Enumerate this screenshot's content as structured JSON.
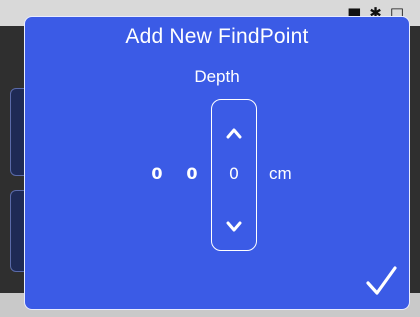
{
  "dialog": {
    "title": "Add New FindPoint",
    "depth_label": "Depth",
    "digits": [
      "0",
      "0"
    ],
    "spinner_value": "0",
    "unit": "cm",
    "confirm_icon": "checkmark-icon"
  },
  "colors": {
    "dialog_background": "#3b5be6",
    "dialog_border": "#e8ecff",
    "text": "#ffffff"
  }
}
